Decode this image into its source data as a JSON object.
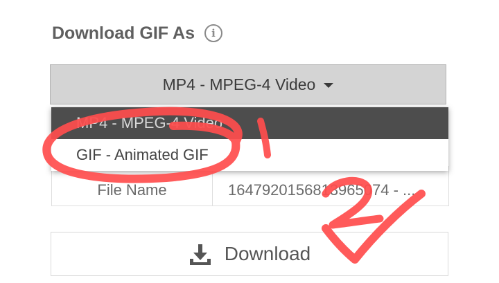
{
  "heading": {
    "title": "Download GIF As",
    "info_icon": "info-icon"
  },
  "select": {
    "value": "MP4 - MPEG-4 Video",
    "icon": "chevron-down-icon"
  },
  "dropdown": {
    "options": [
      "MP4 - MPEG-4 Video",
      "GIF - Animated GIF"
    ],
    "selected_index": 0
  },
  "details": {
    "file_name_label": "File Name",
    "file_name_value": "1647920156813965074 - ..."
  },
  "download": {
    "label": "Download",
    "icon": "download-icon"
  },
  "annotations": {
    "color": "#ff4d4d",
    "marks": [
      "1",
      "2"
    ]
  }
}
